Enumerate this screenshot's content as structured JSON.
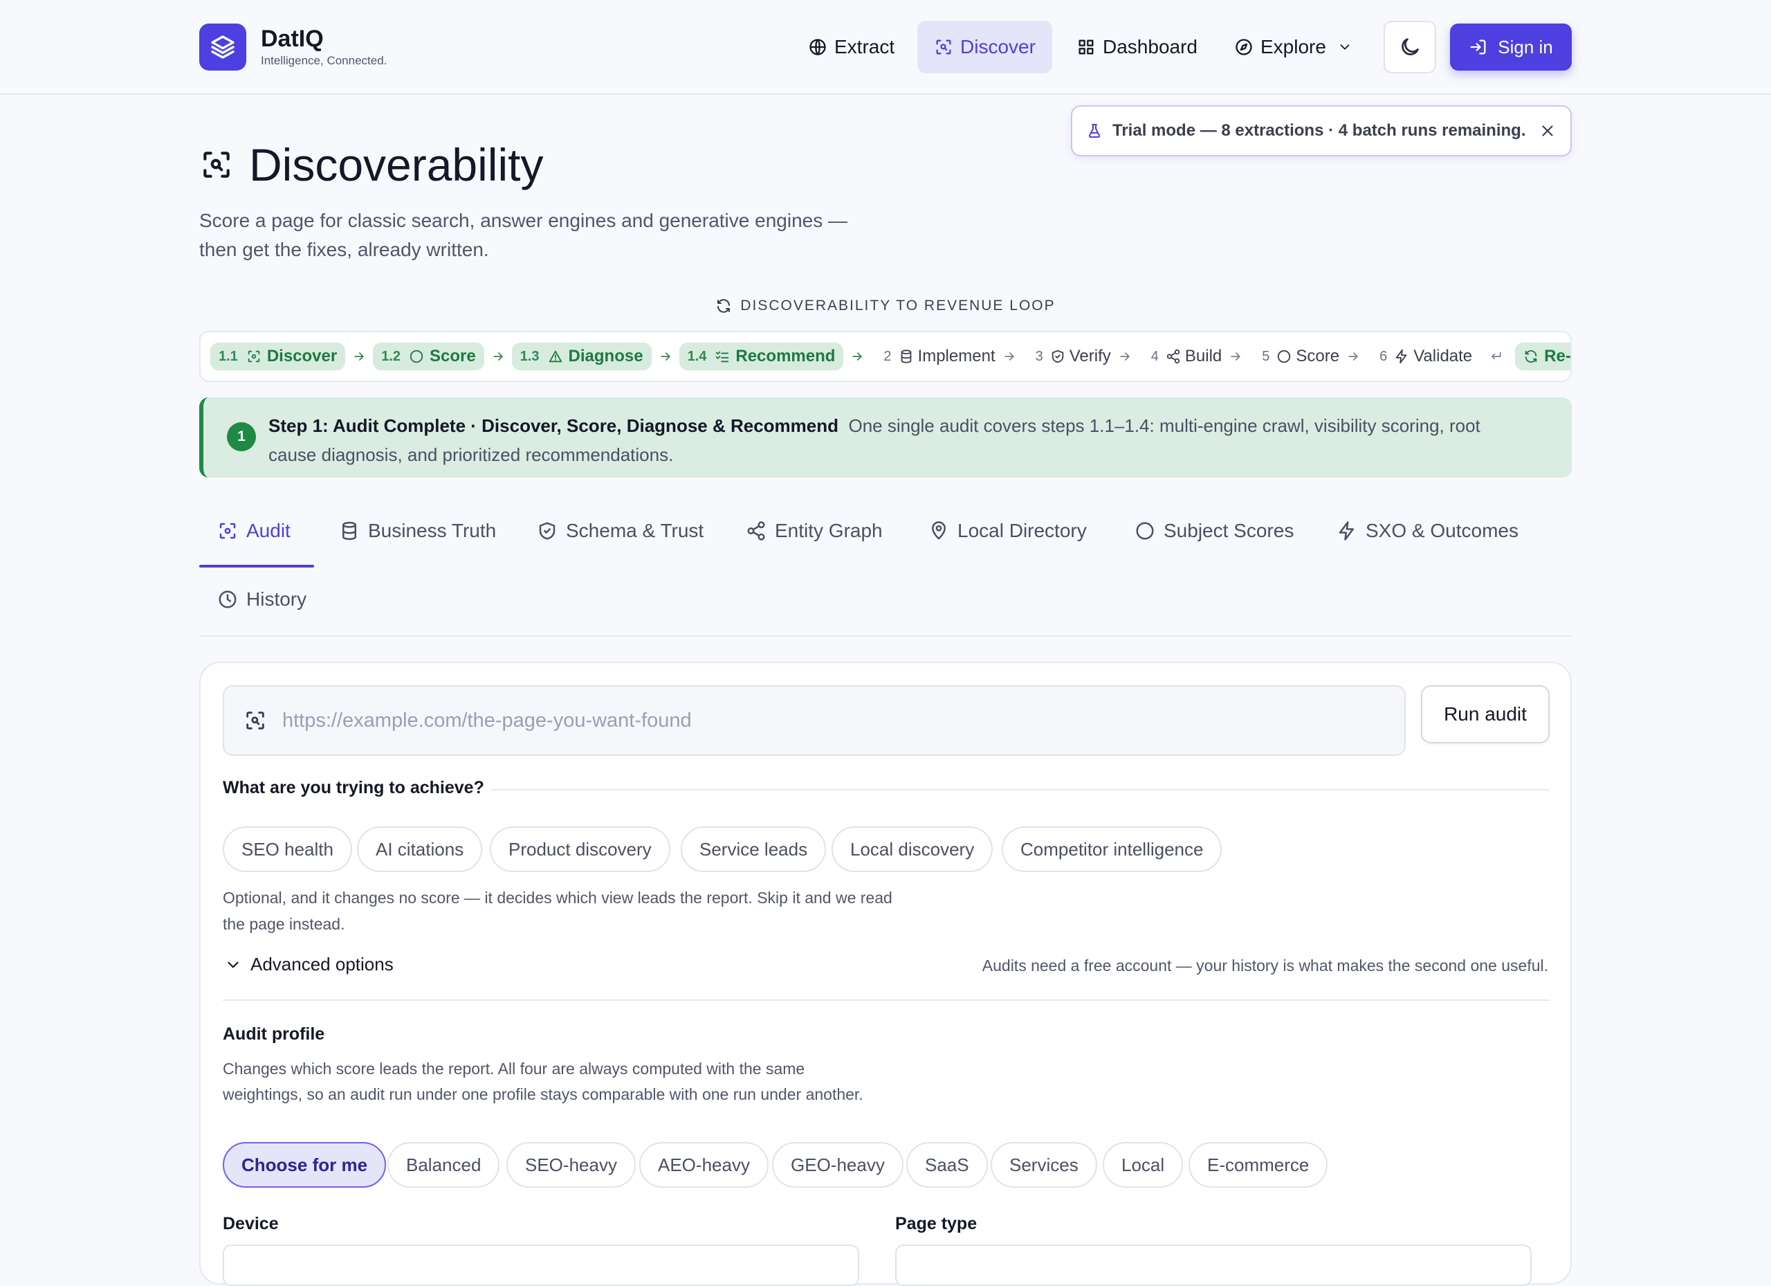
{
  "brand": {
    "name": "DatIQ",
    "tagline": "Intelligence, Connected."
  },
  "nav": {
    "items": [
      {
        "label": "Extract",
        "icon": "globe-icon"
      },
      {
        "label": "Discover",
        "icon": "scan-icon",
        "active": true
      },
      {
        "label": "Dashboard",
        "icon": "grid-icon"
      },
      {
        "label": "Explore",
        "icon": "compass-icon"
      }
    ],
    "theme_icon": "moon-icon",
    "signin_label": "Sign in"
  },
  "trial": {
    "text": "Trial mode — 8 extractions · 4 batch runs remaining."
  },
  "page": {
    "title": "Discoverability",
    "subtitle": "Score a page for classic search, answer engines and generative engines — then get the fixes, already written."
  },
  "loop": {
    "title": "DISCOVERABILITY TO REVENUE LOOP",
    "steps": [
      {
        "num": "1.1",
        "label": "Discover",
        "done": true
      },
      {
        "num": "1.2",
        "label": "Score",
        "done": true
      },
      {
        "num": "1.3",
        "label": "Diagnose",
        "done": true
      },
      {
        "num": "1.4",
        "label": "Recommend",
        "done": true
      },
      {
        "num": "2",
        "label": "Implement"
      },
      {
        "num": "3",
        "label": "Verify"
      },
      {
        "num": "4",
        "label": "Build"
      },
      {
        "num": "5",
        "label": "Score"
      },
      {
        "num": "6",
        "label": "Validate"
      },
      {
        "num": "",
        "label": "Re-audit"
      }
    ]
  },
  "banner": {
    "number": "1",
    "title": "Step 1: Audit Complete · Discover, Score, Diagnose & Recommend",
    "text": "One single audit covers steps 1.1–1.4: multi-engine crawl, visibility scoring, root cause diagnosis, and prioritized recommendations."
  },
  "tabs": [
    {
      "label": "Audit",
      "active": true
    },
    {
      "label": "Business Truth"
    },
    {
      "label": "Schema & Trust"
    },
    {
      "label": "Entity Graph"
    },
    {
      "label": "Local Directory"
    },
    {
      "label": "Subject Scores"
    },
    {
      "label": "SXO & Outcomes"
    },
    {
      "label": "History"
    }
  ],
  "audit": {
    "url_placeholder": "https://example.com/the-page-you-want-found",
    "url_value": "",
    "run_label": "Run audit",
    "goal_label": "What are you trying to achieve?",
    "goals": [
      "SEO health",
      "AI citations",
      "Product discovery",
      "Service leads",
      "Local discovery",
      "Competitor intelligence"
    ],
    "goal_hint": "Optional, and it changes no score — it decides which view leads the report. Skip it and we read the page instead.",
    "advanced_label": "Advanced options",
    "account_note": "Audits need a free account — your history is what makes the second one useful.",
    "profile_label": "Audit profile",
    "profile_desc": "Changes which score leads the report. All four are always computed with the same weightings, so an audit run under one profile stays comparable with one run under another.",
    "profiles": [
      "Choose for me",
      "Balanced",
      "SEO-heavy",
      "AEO-heavy",
      "GEO-heavy",
      "SaaS",
      "Services",
      "Local",
      "E-commerce"
    ],
    "profile_selected": "Choose for me",
    "device_label": "Device",
    "page_type_label": "Page type"
  },
  "colors": {
    "accent": "#4d3fe0",
    "success": "#1e8a45",
    "success_bg": "#dbece2"
  }
}
